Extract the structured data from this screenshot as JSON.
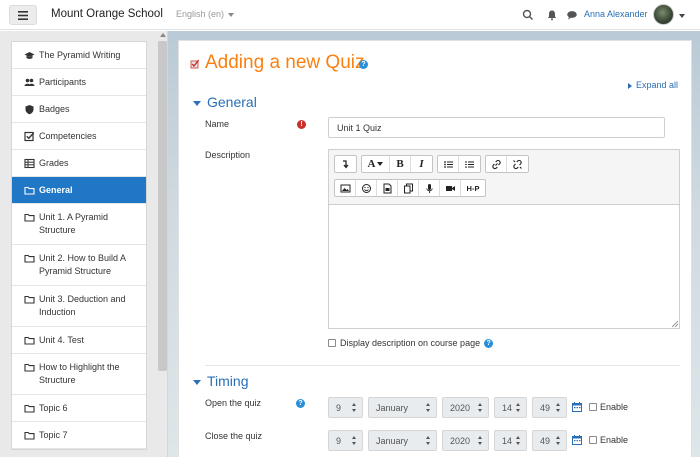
{
  "navbar": {
    "site_name": "Mount Orange School",
    "language": "English (en)",
    "user_name": "Anna Alexander",
    "icons": [
      "hamburger-icon",
      "search-icon",
      "bell-icon",
      "chat-icon"
    ]
  },
  "sidebar": {
    "items": [
      {
        "label": "The Pyramid Writing",
        "icon": "graduation-cap-icon"
      },
      {
        "label": "Participants",
        "icon": "users-icon"
      },
      {
        "label": "Badges",
        "icon": "shield-icon"
      },
      {
        "label": "Competencies",
        "icon": "check-square-icon"
      },
      {
        "label": "Grades",
        "icon": "table-icon"
      },
      {
        "label": "General",
        "icon": "folder-icon",
        "active": true
      },
      {
        "label": "Unit 1. A Pyramid Structure",
        "icon": "folder-icon"
      },
      {
        "label": "Unit 2. How to Build A Pyramid Structure",
        "icon": "folder-icon"
      },
      {
        "label": "Unit 3. Deduction and Induction",
        "icon": "folder-icon"
      },
      {
        "label": "Unit 4. Test",
        "icon": "folder-icon"
      },
      {
        "label": "How to Highlight the Structure",
        "icon": "folder-icon"
      },
      {
        "label": "Topic 6",
        "icon": "folder-icon"
      },
      {
        "label": "Topic 7",
        "icon": "folder-icon"
      }
    ]
  },
  "main": {
    "title": "Adding a new Quiz",
    "expand_all": "Expand all",
    "general": {
      "heading": "General",
      "name_label": "Name",
      "name_value": "Unit 1 Quiz",
      "description_label": "Description",
      "display_description": "Display description on course page"
    },
    "timing": {
      "heading": "Timing",
      "open_label": "Open the quiz",
      "close_label": "Close the quiz",
      "open": {
        "day": "9",
        "month": "January",
        "year": "2020",
        "hour": "14",
        "minute": "49",
        "enable": "Enable"
      },
      "close": {
        "day": "9",
        "month": "January",
        "year": "2020",
        "hour": "14",
        "minute": "49",
        "enable": "Enable"
      }
    }
  },
  "editor_toolbar": {
    "row1": [
      "collapse-icon",
      "font-color-icon",
      "bold-icon",
      "italic-icon",
      "unordered-list-icon",
      "ordered-list-icon",
      "link-icon",
      "unlink-icon"
    ],
    "row2": [
      "image-icon",
      "emoji-icon",
      "media-icon",
      "manage-files-icon",
      "record-audio-icon",
      "record-video-icon",
      "h5p-icon"
    ],
    "font_label": "A",
    "bold_label": "B",
    "italic_label": "I",
    "h5p_label": "H-P"
  },
  "colors": {
    "accent": "#f98012",
    "link": "#2a6fb7",
    "active": "#1f77c6",
    "required": "#c9302c"
  }
}
